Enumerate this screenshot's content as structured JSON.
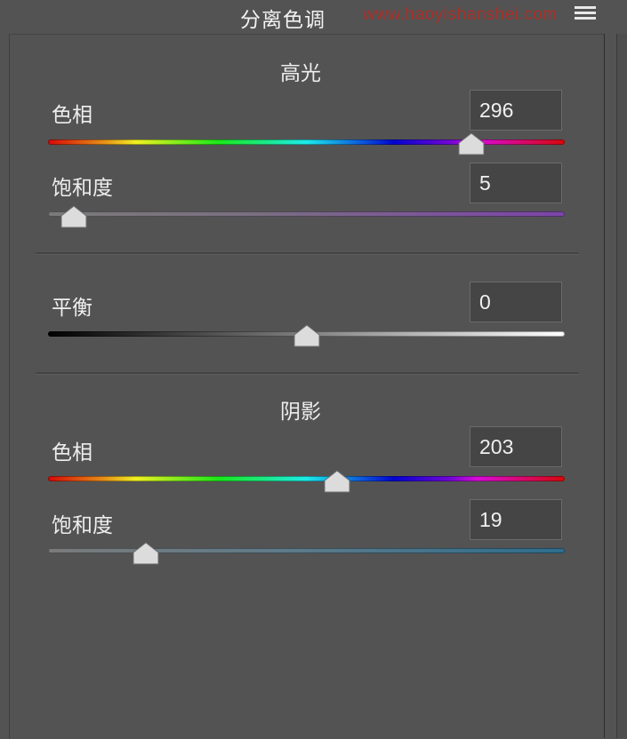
{
  "header": {
    "title": "分离色调",
    "watermark": "www.haoyishanshei.com",
    "menu_icon": "panel-menu-icon"
  },
  "highlights": {
    "title": "高光",
    "hue": {
      "label": "色相",
      "value": "296"
    },
    "saturation": {
      "label": "饱和度",
      "value": "5"
    }
  },
  "balance": {
    "label": "平衡",
    "value": "0"
  },
  "shadows": {
    "title": "阴影",
    "hue": {
      "label": "色相",
      "value": "203"
    },
    "saturation": {
      "label": "饱和度",
      "value": "19"
    }
  },
  "slider_levels": {
    "highlight_hue": 0.82,
    "highlight_saturation": 0.05,
    "balance": 0.5,
    "shadow_hue": 0.56,
    "shadow_saturation": 0.19
  },
  "colors": {
    "panel_bg": "#535353",
    "field_bg": "#454545",
    "thumb": "#dcdcdc"
  }
}
